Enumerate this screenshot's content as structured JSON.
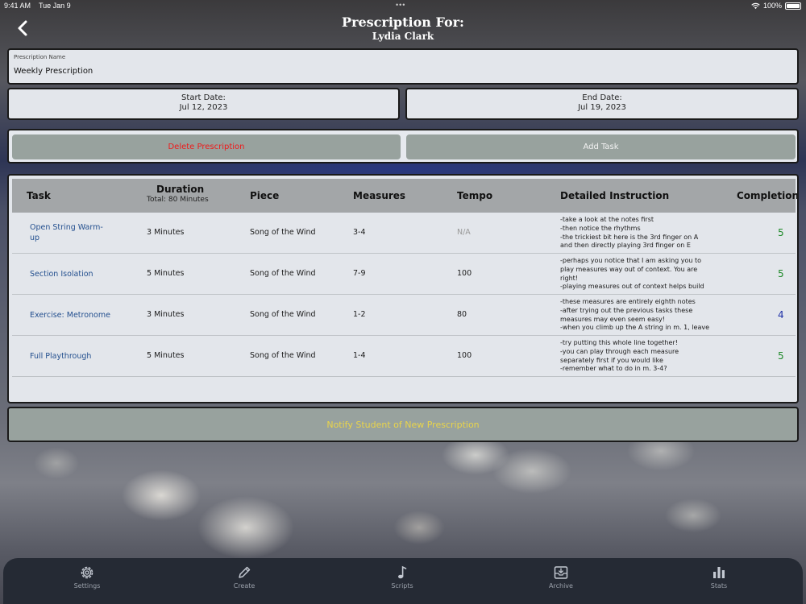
{
  "status_bar": {
    "time": "9:41 AM",
    "date": "Tue Jan 9",
    "dots": "•••",
    "battery": "100%"
  },
  "header": {
    "title": "Prescription For:",
    "student_name": "Lydia Clark"
  },
  "prescription": {
    "name_label": "Prescription Name",
    "name_value": "Weekly Prescription"
  },
  "dates": {
    "start_label": "Start Date:",
    "start_value": "Jul 12, 2023",
    "end_label": "End Date:",
    "end_value": "Jul 19, 2023"
  },
  "actions": {
    "delete_label": "Delete Prescription",
    "add_label": "Add Task"
  },
  "table": {
    "headers": {
      "task": "Task",
      "duration": "Duration",
      "duration_total": "Total: 80 Minutes",
      "piece": "Piece",
      "measures": "Measures",
      "tempo": "Tempo",
      "instruction": "Detailed Instruction",
      "completion": "Completions"
    },
    "rows": [
      {
        "task": "Open String Warm-up",
        "duration": "3 Minutes",
        "piece": "Song of the Wind",
        "measures": "3-4",
        "tempo": "N/A",
        "instructions": [
          "-take a look at the notes first",
          "-then notice the rhythms",
          "-the trickiest bit here is the 3rd finger on A",
          "and then directly playing 3rd finger on E"
        ],
        "completion": "5"
      },
      {
        "task": "Section Isolation",
        "duration": "5 Minutes",
        "piece": "Song of the Wind",
        "measures": "7-9",
        "tempo": "100",
        "instructions": [
          "-perhaps you notice that I am asking you to",
          "play measures way out of context. You are",
          "right!",
          "-playing measures out of context helps build"
        ],
        "completion": "5"
      },
      {
        "task": "Exercise: Metronome",
        "duration": "3 Minutes",
        "piece": "Song of the Wind",
        "measures": "1-2",
        "tempo": "80",
        "instructions": [
          "-these measures are entirely eighth notes",
          "-after trying out the previous tasks these",
          "measures may even seem easy!",
          "-when you climb up the A string in m. 1, leave"
        ],
        "completion": "4"
      },
      {
        "task": "Full Playthrough",
        "duration": "5 Minutes",
        "piece": "Song of the Wind",
        "measures": "1-4",
        "tempo": "100",
        "instructions": [
          "-try putting this whole line together!",
          "-you can play through each measure",
          "separately first if you would like",
          "-remember what to do in m. 3-4?"
        ],
        "completion": "5"
      }
    ]
  },
  "notify": {
    "label": "Notify Student of New Prescription"
  },
  "tabs": [
    {
      "label": "Settings",
      "icon": "gear-icon"
    },
    {
      "label": "Create",
      "icon": "pencil-icon"
    },
    {
      "label": "Scripts",
      "icon": "music-note-icon"
    },
    {
      "label": "Archive",
      "icon": "archive-icon"
    },
    {
      "label": "Stats",
      "icon": "bar-chart-icon"
    }
  ],
  "colors": {
    "delete": "#ee1a1a",
    "notify": "#e9d44a",
    "task_link": "#24508f",
    "completion_high": "#1f8a2a",
    "completion_mid": "#1d2fa6"
  }
}
